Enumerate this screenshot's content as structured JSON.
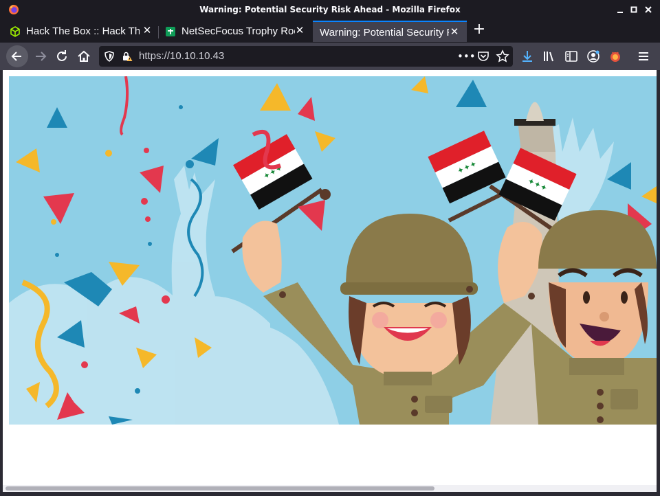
{
  "window": {
    "title": "Warning: Potential Security Risk Ahead - Mozilla Firefox"
  },
  "tabs": [
    {
      "label": "Hack The Box :: Hack The Box",
      "active": false,
      "favicon": "hackthebox-cube-icon"
    },
    {
      "label": "NetSecFocus Trophy Room",
      "active": false,
      "favicon": "green-sheet-icon"
    },
    {
      "label": "Warning: Potential Security Risk Ahead",
      "active": true,
      "favicon": "none"
    }
  ],
  "navbar": {
    "url": "https://10.10.10.43"
  },
  "colors": {
    "accent": "#0a84ff",
    "download": "#54b4ff",
    "hero_sky": "#8ecfe6",
    "helmet": "#8a7a4a",
    "flag_red": "#e0202a",
    "flag_green": "#1a8a3a"
  },
  "icons": [
    "firefox-icon",
    "minimize-icon",
    "maximize-icon",
    "close-icon",
    "back-icon",
    "forward-icon",
    "reload-icon",
    "home-icon",
    "shield-icon",
    "insecure-lock-icon",
    "more-icon",
    "pocket-icon",
    "bookmark-star-icon",
    "download-icon",
    "library-icon",
    "sidebar-icon",
    "account-icon",
    "extension-icon",
    "menu-icon"
  ]
}
